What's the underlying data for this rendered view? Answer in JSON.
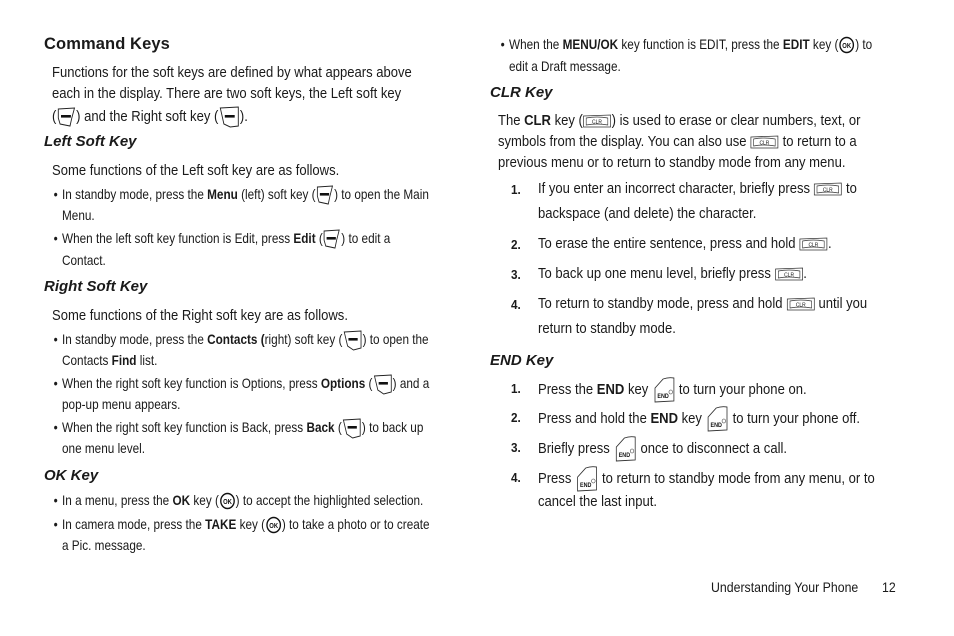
{
  "left": {
    "title": "Command Keys",
    "intro": {
      "line1": "Functions for the soft keys are defined by what appears above",
      "line2": "each in the display. There are two soft keys, the Left soft key",
      "line3a": ") and the Right soft key (",
      "line3b": ")."
    },
    "left_soft": {
      "heading": "Left Soft Key",
      "intro": "Some functions of the Left soft key are as follows.",
      "b1": {
        "pre": "In standby mode, press the ",
        "bold": "Menu",
        "mid": " (left) soft key (",
        "post": ") to open the Main",
        "cont": "Menu."
      },
      "b2": {
        "pre": "When the left soft key function is Edit, press ",
        "bold": "Edit",
        "mid": " (",
        "post": ") to edit a",
        "cont": "Contact."
      }
    },
    "right_soft": {
      "heading": "Right Soft Key",
      "intro": "Some functions of the Right soft key are as follows.",
      "b1": {
        "pre": "In standby mode, press the ",
        "bold": "Contacts (",
        "mid": "right) soft key (",
        "post": ") to open the",
        "cont_pre": "Contacts ",
        "cont_bold": "Find",
        "cont_post": " list."
      },
      "b2": {
        "pre": "When the right soft key function is Options, press ",
        "bold": "Options",
        "mid": " (",
        "post": ") and a",
        "cont": "pop-up menu appears."
      },
      "b3": {
        "pre": "When the right soft key function is Back, press ",
        "bold": "Back",
        "mid": " (",
        "post": ") to back up",
        "cont": "one menu level."
      }
    },
    "ok": {
      "heading": "OK Key",
      "b1": {
        "pre": "In a menu, press the ",
        "bold": "OK",
        "mid": " key (",
        "post": ") to accept the highlighted selection."
      },
      "b2": {
        "pre": "In camera mode, press the ",
        "bold": "TAKE",
        "mid": " key (",
        "post": ") to take a photo or to create",
        "cont": "a Pic. message."
      }
    }
  },
  "right": {
    "ok_b3": {
      "pre": "When the ",
      "bold1": "MENU/OK",
      "mid1": " key function is EDIT, press the ",
      "bold2": "EDIT",
      "mid2": " key (",
      "post": ") to",
      "cont": "edit a Draft message."
    },
    "clr": {
      "heading": "CLR Key",
      "p_line1_pre": "The ",
      "p_line1_bold": "CLR",
      "p_line1_mid": " key (",
      "p_line1_post": ") is used to erase or clear numbers, text, or",
      "p_line2_pre": "symbols from the display. You can also use ",
      "p_line2_post": " to return to a",
      "p_line3": "previous menu or to return to standby mode from any menu.",
      "steps": [
        {
          "n": "1.",
          "pre": "If you enter an incorrect character, briefly press ",
          "post": " to",
          "cont": "backspace (and delete) the character."
        },
        {
          "n": "2.",
          "pre": "To erase the entire sentence, press and hold ",
          "post": "."
        },
        {
          "n": "3.",
          "pre": "To back up one menu level, briefly press ",
          "post": "."
        },
        {
          "n": "4.",
          "pre": "To return to standby mode, press and hold ",
          "post": " until you",
          "cont": "return to standby mode."
        }
      ]
    },
    "end": {
      "heading": "END Key",
      "steps": [
        {
          "n": "1.",
          "pre": "Press the ",
          "bold": "END",
          "mid": " key ",
          "post": " to turn your phone on."
        },
        {
          "n": "2.",
          "pre": "Press and hold the ",
          "bold": "END",
          "mid": " key ",
          "post": " to turn your phone off."
        },
        {
          "n": "3.",
          "pre": "Briefly press ",
          "post": " once to disconnect a call."
        },
        {
          "n": "4.",
          "pre": "Press ",
          "post": " to return to standby mode from any menu, or to",
          "cont": "cancel the last input."
        }
      ]
    }
  },
  "icons": {
    "clr_label": "CLR",
    "ok_label": "OK",
    "end_label": "END"
  },
  "footer": {
    "section": "Understanding Your Phone",
    "page": "12"
  }
}
